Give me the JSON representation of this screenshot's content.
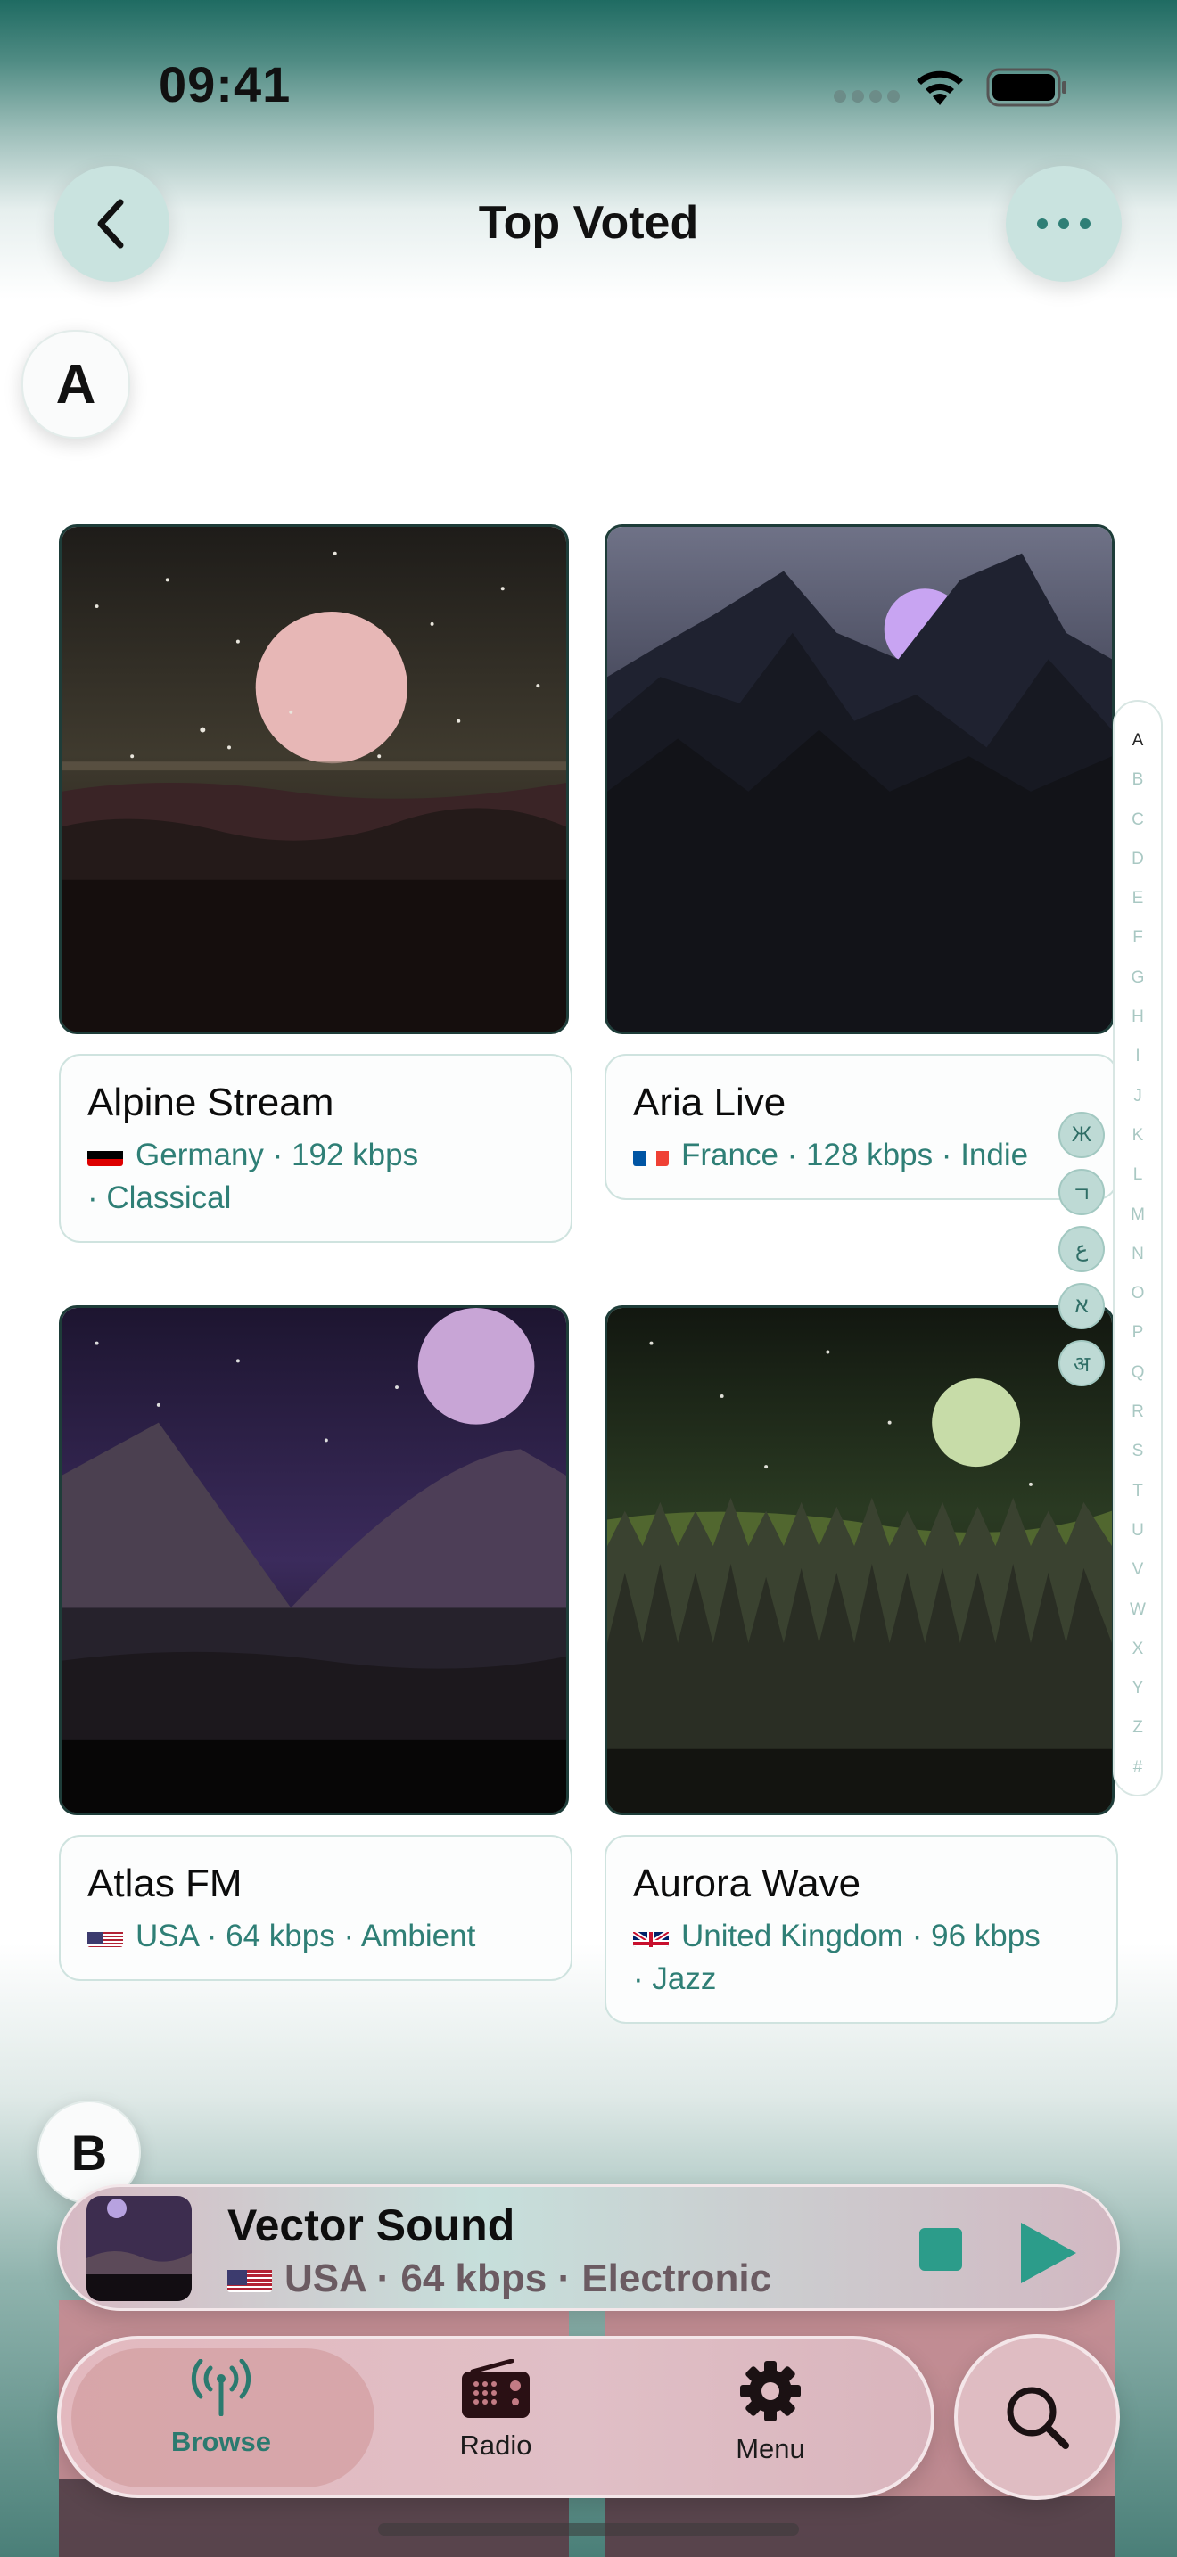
{
  "status_bar": {
    "time": "09:41"
  },
  "header": {
    "title": "Top Voted"
  },
  "sections": [
    {
      "letter": "A",
      "stations": [
        {
          "name": "Alpine Stream",
          "country": "Germany",
          "flag": "germany-flag-icon",
          "meta_line1": "Germany · 192 kbps",
          "meta_line2": "· Classical"
        },
        {
          "name": "Aria Live",
          "country": "France",
          "flag": "france-flag-icon",
          "meta_line1": "France · 128 kbps · Indie",
          "meta_line2": ""
        },
        {
          "name": "Atlas FM",
          "country": "USA",
          "flag": "usa-flag-icon",
          "meta_line1": "USA · 64 kbps · Ambient",
          "meta_line2": ""
        },
        {
          "name": "Aurora Wave",
          "country": "United Kingdom",
          "flag": "uk-flag-icon",
          "meta_line1": "United Kingdom · 96 kbps",
          "meta_line2": "· Jazz"
        }
      ]
    },
    {
      "letter": "B",
      "stations": []
    }
  ],
  "index_bar": {
    "letters": [
      "A",
      "B",
      "C",
      "D",
      "E",
      "F",
      "G",
      "H",
      "I",
      "J",
      "K",
      "L",
      "M",
      "N",
      "O",
      "P",
      "Q",
      "R",
      "S",
      "T",
      "U",
      "V",
      "W",
      "X",
      "Y",
      "Z",
      "#"
    ],
    "active": "A",
    "scripts": [
      "Ж",
      "ㄱ",
      "ع",
      "א",
      "अ"
    ]
  },
  "now_playing": {
    "title": "Vector Sound",
    "meta": "USA · 64 kbps · Electronic",
    "flag": "usa-flag-icon"
  },
  "tab_bar": {
    "tabs": [
      {
        "label": "Browse",
        "icon": "broadcast-icon",
        "active": true
      },
      {
        "label": "Radio",
        "icon": "radio-icon",
        "active": false
      },
      {
        "label": "Menu",
        "icon": "gear-icon",
        "active": false
      }
    ],
    "search_icon": "search-icon"
  },
  "colors": {
    "accent": "#2f7f76",
    "play": "#2c9c8a"
  }
}
